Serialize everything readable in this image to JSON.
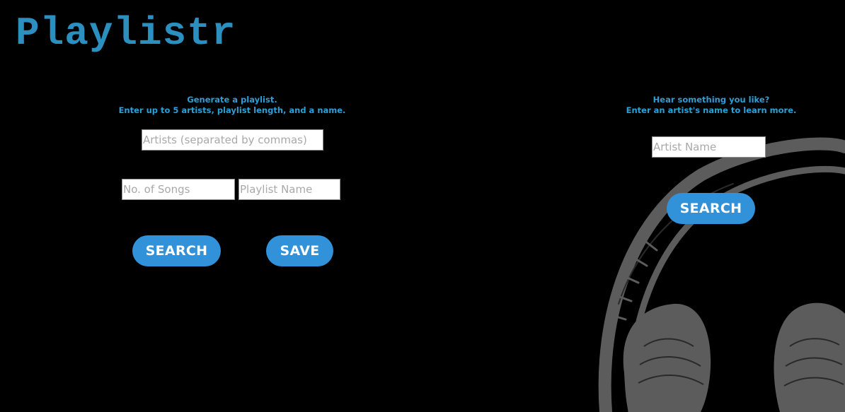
{
  "app": {
    "title": "Playlistr",
    "brand_color": "#2b8fbf",
    "accent_color": "#3191d9"
  },
  "generator": {
    "intro_line1": "Generate a playlist.",
    "intro_line2": "Enter up to 5 artists, playlist length, and a name.",
    "artists_placeholder": "Artists (separated by commas)",
    "artists_value": "",
    "songs_placeholder": "No. of Songs",
    "songs_value": "",
    "name_placeholder": "Playlist Name",
    "name_value": "",
    "search_label": "SEARCH",
    "save_label": "SAVE"
  },
  "artist_lookup": {
    "intro_line1": "Hear something you like?",
    "intro_line2": "Enter an artist's name to learn more.",
    "artist_placeholder": "Artist Name",
    "artist_value": "",
    "search_label": "SEARCH"
  },
  "background": {
    "image": "headphones-illustration"
  }
}
